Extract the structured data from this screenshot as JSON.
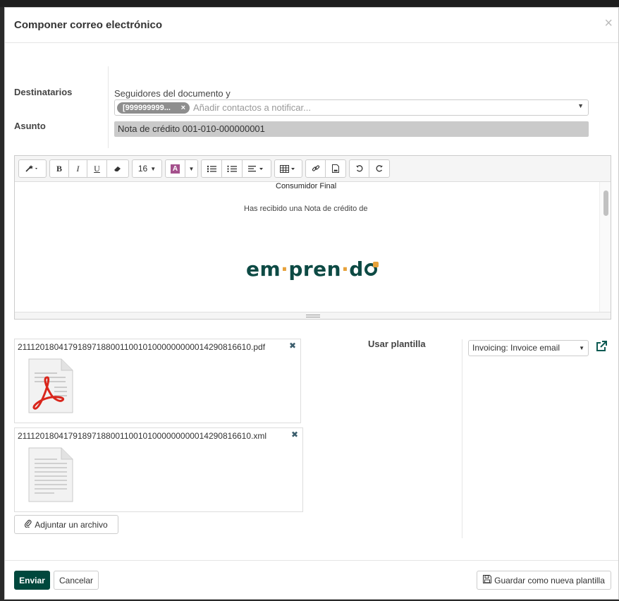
{
  "dialog": {
    "title": "Componer correo electrónico",
    "close_glyph": "×"
  },
  "form": {
    "recipients_label": "Destinatarios",
    "followers_hint": "Seguidores del documento y",
    "recipient_tag": "[999999999...",
    "recipient_tag_remove": "×",
    "recipients_placeholder": "Añadir contactos a notificar...",
    "subject_label": "Asunto",
    "subject_value": "Nota de crédito 001-010-000000001"
  },
  "toolbar": {
    "font_size": "16",
    "color_glyph": "A",
    "bold": "B",
    "italic": "I",
    "underline": "U"
  },
  "editor": {
    "customer_line": "Consumidor Final",
    "message_line": "Has recibido una Nota de crédito de",
    "logo_text": {
      "part1": "em",
      "part2": "pren",
      "part3": "d"
    },
    "logo_colors": {
      "text": "#0d4a44",
      "dot": "#e7a23b"
    }
  },
  "attachments": [
    {
      "name": "21112018041791897188001100101000000000014290816610.pdf",
      "icon": "pdf-file-icon",
      "remove_glyph": "✖"
    },
    {
      "name": "21112018041791897188001100101000000000014290816610.xml",
      "icon": "text-file-icon",
      "remove_glyph": "✖"
    }
  ],
  "attach_button_label": "Adjuntar un archivo",
  "template": {
    "label": "Usar plantilla",
    "selected": "Invoicing: Invoice email"
  },
  "footer": {
    "send_label": "Enviar",
    "cancel_label": "Cancelar",
    "save_template_label": "Guardar como nueva plantilla"
  },
  "colors": {
    "primary": "#00483d",
    "subject_bg": "#cacaca",
    "tag_bg": "#8e8e8e",
    "pdf_red": "#d9261c"
  }
}
